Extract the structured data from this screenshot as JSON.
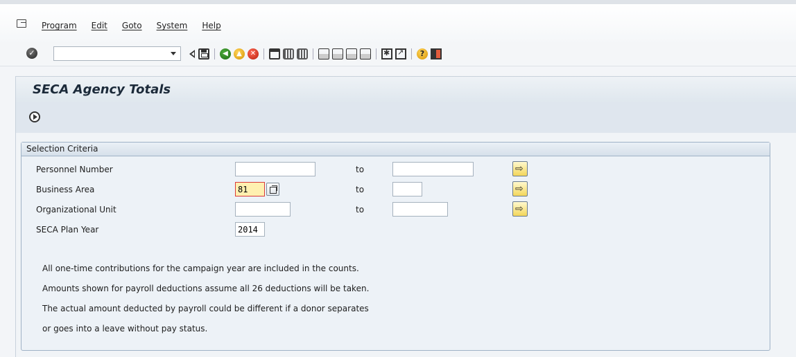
{
  "menu": {
    "items": [
      "Program",
      "Edit",
      "Goto",
      "System",
      "Help"
    ]
  },
  "toolbar": {
    "command_field_value": ""
  },
  "page": {
    "title": "SECA Agency Totals"
  },
  "selection": {
    "group_title": "Selection Criteria",
    "to_label": "to",
    "rows": [
      {
        "label": "Personnel Number",
        "from": "",
        "to": ""
      },
      {
        "label": "Business Area",
        "from": "81",
        "to": ""
      },
      {
        "label": "Organizational Unit",
        "from": "",
        "to": ""
      },
      {
        "label": "SECA Plan Year",
        "value": "2014"
      }
    ]
  },
  "notes": [
    "All one-time contributions for the campaign year are included in the counts.",
    "Amounts shown for payroll deductions assume all 26 deductions will be taken.",
    "The actual amount deducted by payroll could be different if a donor separates",
    "or goes into a leave without pay status."
  ]
}
